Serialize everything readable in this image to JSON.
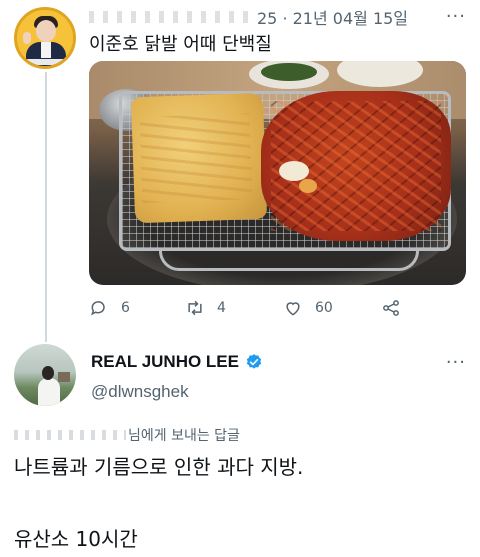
{
  "tweet1": {
    "author_blurred": "blurred-handle",
    "date": "25 · 21년 04월 15일",
    "text": "이준호 닭발 어때 단백질",
    "more": "···",
    "photo_alt": "food-photo",
    "actions": {
      "replies": "6",
      "retweets": "4",
      "likes": "60"
    }
  },
  "tweet2": {
    "name": "REAL JUNHO LEE",
    "handle": "@dlwnsghek",
    "more": "···",
    "reply_to_suffix": "님에게 보내는 답글",
    "line1": "나트륨과 기름으로 인한 과다 지방.",
    "line2": "유산소 10시간"
  },
  "colors": {
    "text": "#0f1419",
    "secondary": "#536471",
    "verified": "#1d9bf0",
    "thread_line": "#cfd9de"
  },
  "icons": [
    "reply-icon",
    "retweet-icon",
    "like-icon",
    "share-icon",
    "verified-badge-icon",
    "more-icon"
  ]
}
